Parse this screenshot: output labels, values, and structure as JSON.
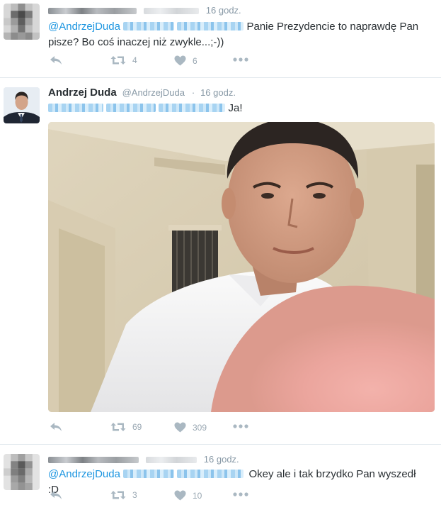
{
  "tweets": [
    {
      "time": "16 godz.",
      "mention": "@AndrzejDuda",
      "text": "Panie Prezydencie to naprawdę Pan pisze? Bo coś inaczej niż zwykle...;-))",
      "retweets": "4",
      "likes": "6"
    },
    {
      "name": "Andrzej Duda",
      "handle": "@AndrzejDuda",
      "separator": "·",
      "time": "16 godz.",
      "text": "Ja!",
      "retweets": "69",
      "likes": "309"
    },
    {
      "time": "16 godz.",
      "mention": "@AndrzejDuda",
      "text": "Okey ale i tak brzydko Pan wyszedł :D",
      "retweets": "3",
      "likes": "10"
    }
  ],
  "colors": {
    "mention": "#1b95e0",
    "muted": "#8899a6",
    "icon": "#aab8c2",
    "separator": "#e1e8ed"
  },
  "icons": [
    "reply-icon",
    "retweet-icon",
    "heart-icon",
    "more-icon"
  ]
}
